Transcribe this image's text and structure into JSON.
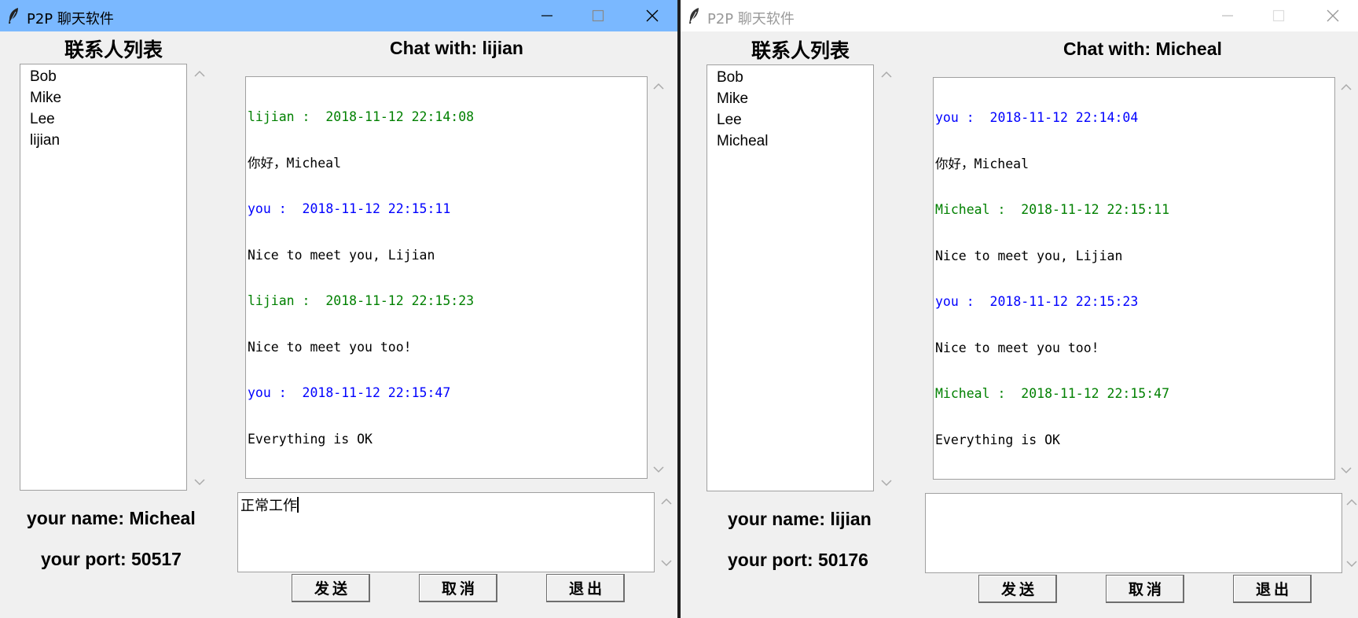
{
  "colors": {
    "active_titlebar": "#7ab8ff",
    "window_bg": "#f0f0f0",
    "self_message": "#0000ff",
    "peer_message": "#008000"
  },
  "left": {
    "window_title": "P2P 聊天软件",
    "contacts_heading": "联系人列表",
    "contacts": [
      "Bob",
      "Mike",
      "Lee",
      "lijian"
    ],
    "chat_heading": "Chat with: lijian",
    "messages": [
      {
        "header": "lijian :  2018-11-12 22:14:08",
        "body": "你好，Micheal"
      },
      {
        "header": "you :  2018-11-12 22:15:11",
        "body": "Nice to meet you, Lijian"
      },
      {
        "header": "lijian :  2018-11-12 22:15:23",
        "body": "Nice to meet you too!"
      },
      {
        "header": "you :  2018-11-12 22:15:47",
        "body": "Everything is OK"
      }
    ],
    "input_value": "正常工作",
    "your_name": "your name: Micheal",
    "your_port": "your port: 50517",
    "send_label": "发送",
    "cancel_label": "取消",
    "exit_label": "退出"
  },
  "right": {
    "window_title": "P2P 聊天软件",
    "contacts_heading": "联系人列表",
    "contacts": [
      "Bob",
      "Mike",
      "Lee",
      "Micheal"
    ],
    "chat_heading": "Chat with: Micheal",
    "messages": [
      {
        "header": "you :  2018-11-12 22:14:04",
        "body": "你好，Micheal"
      },
      {
        "header": "Micheal :  2018-11-12 22:15:11",
        "body": "Nice to meet you, Lijian"
      },
      {
        "header": "you :  2018-11-12 22:15:23",
        "body": "Nice to meet you too!"
      },
      {
        "header": "Micheal :  2018-11-12 22:15:47",
        "body": "Everything is OK"
      }
    ],
    "input_value": "",
    "your_name": "your name: lijian",
    "your_port": "your port: 50176",
    "send_label": "发送",
    "cancel_label": "取消",
    "exit_label": "退出"
  }
}
